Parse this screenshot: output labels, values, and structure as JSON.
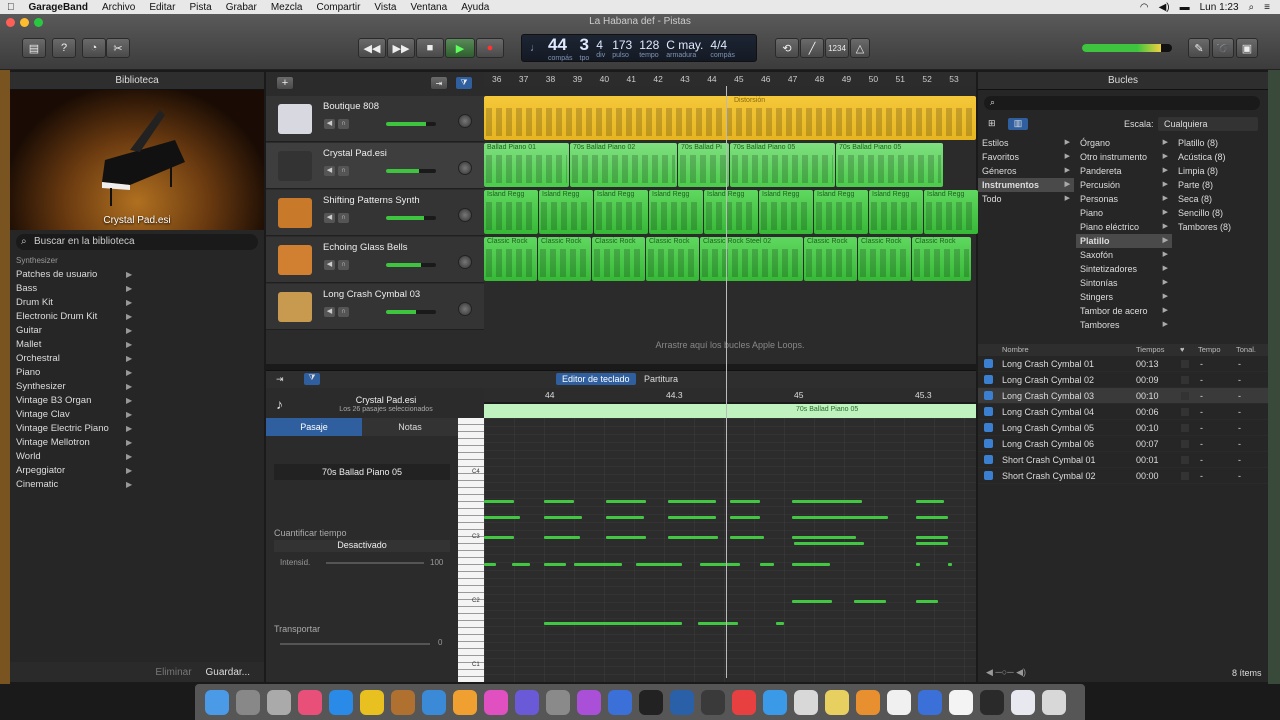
{
  "menubar": {
    "app": "GarageBand",
    "items": [
      "Archivo",
      "Editar",
      "Pista",
      "Grabar",
      "Mezcla",
      "Compartir",
      "Vista",
      "Ventana",
      "Ayuda"
    ],
    "clock": "Lun 1:23"
  },
  "window": {
    "title": "La Habana def - Pistas"
  },
  "lcd": {
    "bar": "44",
    "beat": "3",
    "div": "4",
    "tick": "173",
    "tempo": "128",
    "key": "C may.",
    "sig": "4/4",
    "lbl_compas": "compás",
    "lbl_tiempo": "tpo",
    "lbl_div": "div",
    "lbl_pulso": "pulso",
    "lbl_tempo": "tempo",
    "lbl_armadura": "armadura",
    "lbl_compas2": "compás",
    "count_in": "1234"
  },
  "library": {
    "title": "Biblioteca",
    "image_caption": "Crystal Pad.esi",
    "search_placeholder": "Buscar en la biblioteca",
    "crumb": "Synthesizer",
    "items": [
      "Patches de usuario",
      "Bass",
      "Drum Kit",
      "Electronic Drum Kit",
      "Guitar",
      "Mallet",
      "Orchestral",
      "Piano",
      "Synthesizer",
      "Vintage B3 Organ",
      "Vintage Clav",
      "Vintage Electric Piano",
      "Vintage Mellotron",
      "World",
      "Arpeggiator",
      "Cinematic"
    ],
    "delete": "Eliminar",
    "save": "Guardar..."
  },
  "tracks": [
    {
      "name": "Boutique 808",
      "level": 0.8
    },
    {
      "name": "Crystal Pad.esi",
      "level": 0.65
    },
    {
      "name": "Shifting Patterns Synth",
      "level": 0.75
    },
    {
      "name": "Echoing Glass Bells",
      "level": 0.7
    },
    {
      "name": "Long Crash Cymbal 03",
      "level": 0.6
    }
  ],
  "ruler": [
    "36",
    "37",
    "38",
    "39",
    "40",
    "41",
    "42",
    "43",
    "44",
    "45",
    "46",
    "47",
    "48",
    "49",
    "50",
    "51",
    "52",
    "53"
  ],
  "regions": {
    "boutique": "Distorsión",
    "pad": [
      "Ballad Piano 01",
      "70s Ballad Piano 02",
      "70s Ballad Pi",
      "70s Ballad Piano 05",
      "70s Ballad Piano 05"
    ],
    "synth": [
      "Island Regg",
      "Island Regg",
      "Island Regg",
      "Island Regg",
      "Island Regg",
      "Island Regg",
      "Island Regg",
      "Island Regg",
      "Island Regg"
    ],
    "bells": [
      "Classic Rock",
      "Classic Rock",
      "Classic Rock",
      "Classic Rock",
      "Classic Rock Steel 02",
      "Classic Rock",
      "Classic Rock",
      "Classic Rock"
    ]
  },
  "drop_hint": "Arrastre aquí los bucles Apple Loops.",
  "editor": {
    "tab_keyboard": "Editor de teclado",
    "tab_score": "Partitura",
    "region_title": "Crystal Pad.esi",
    "region_sub": "Los 26 pasajes seleccionados",
    "tab_region": "Pasaje",
    "tab_notes": "Notas",
    "region_name": "70s Ballad Piano 05",
    "quantize_label": "Cuantificar tiempo",
    "quantize_value": "Desactivado",
    "intensity_label": "Intensid.",
    "intensity_value": "100",
    "transpose_label": "Transportar",
    "transpose_value": "0",
    "ruler": [
      "44",
      "44.3",
      "45",
      "45.3"
    ],
    "region_strip": "70s Ballad Piano 05",
    "keys": [
      "C4",
      "C3",
      "C2",
      "C1"
    ]
  },
  "loops": {
    "title": "Bucles",
    "scale_label": "Escala:",
    "scale_value": "Cualquiera",
    "col1": [
      "Estilos",
      "Favoritos",
      "Géneros",
      "Instrumentos",
      "Todo"
    ],
    "col2": [
      "Órgano",
      "Otro instrumento",
      "Pandereta",
      "Percusión",
      "Personas",
      "Piano",
      "Piano eléctrico",
      "Platillo",
      "Saxofón",
      "Sintetizadores",
      "Sintonías",
      "Stingers",
      "Tambor de acero",
      "Tambores"
    ],
    "col3": [
      "Platillo (8)",
      "Acústica (8)",
      "Limpia (8)",
      "Parte (8)",
      "Seca (8)",
      "Sencillo (8)",
      "Tambores (8)"
    ],
    "headers": {
      "name": "Nombre",
      "beats": "Tiempos",
      "tempo": "Tempo",
      "key": "Tonal."
    },
    "rows": [
      {
        "name": "Long Crash Cymbal 01",
        "beats": "00:13",
        "tempo": "-",
        "key": "-"
      },
      {
        "name": "Long Crash Cymbal 02",
        "beats": "00:09",
        "tempo": "-",
        "key": "-"
      },
      {
        "name": "Long Crash Cymbal 03",
        "beats": "00:10",
        "tempo": "-",
        "key": "-"
      },
      {
        "name": "Long Crash Cymbal 04",
        "beats": "00:06",
        "tempo": "-",
        "key": "-"
      },
      {
        "name": "Long Crash Cymbal 05",
        "beats": "00:10",
        "tempo": "-",
        "key": "-"
      },
      {
        "name": "Long Crash Cymbal 06",
        "beats": "00:07",
        "tempo": "-",
        "key": "-"
      },
      {
        "name": "Short Crash Cymbal 01",
        "beats": "00:01",
        "tempo": "-",
        "key": "-"
      },
      {
        "name": "Short Crash Cymbal 02",
        "beats": "00:00",
        "tempo": "-",
        "key": "-"
      }
    ],
    "count": "8 ítems"
  },
  "colors": {
    "green": "#41c741",
    "yellow": "#f2c230",
    "lcd": "#1d2533"
  }
}
